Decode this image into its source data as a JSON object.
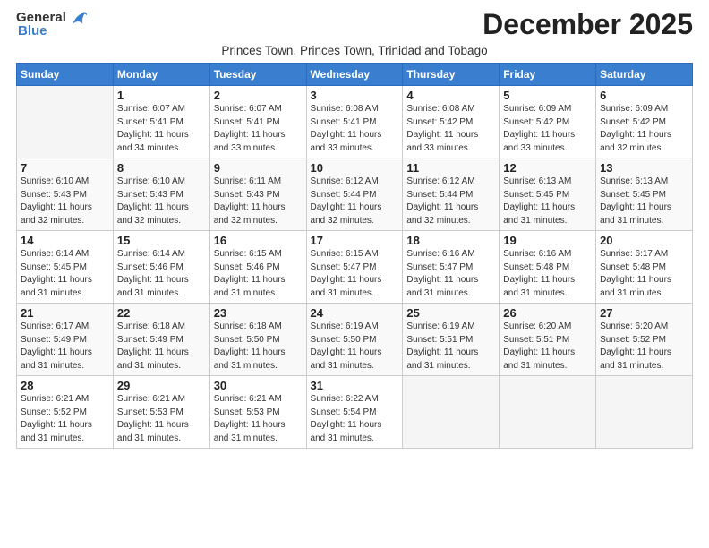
{
  "logo": {
    "general": "General",
    "blue": "Blue"
  },
  "title": "December 2025",
  "subtitle": "Princes Town, Princes Town, Trinidad and Tobago",
  "days_header": [
    "Sunday",
    "Monday",
    "Tuesday",
    "Wednesday",
    "Thursday",
    "Friday",
    "Saturday"
  ],
  "weeks": [
    [
      {
        "num": "",
        "info": ""
      },
      {
        "num": "1",
        "info": "Sunrise: 6:07 AM\nSunset: 5:41 PM\nDaylight: 11 hours\nand 34 minutes."
      },
      {
        "num": "2",
        "info": "Sunrise: 6:07 AM\nSunset: 5:41 PM\nDaylight: 11 hours\nand 33 minutes."
      },
      {
        "num": "3",
        "info": "Sunrise: 6:08 AM\nSunset: 5:41 PM\nDaylight: 11 hours\nand 33 minutes."
      },
      {
        "num": "4",
        "info": "Sunrise: 6:08 AM\nSunset: 5:42 PM\nDaylight: 11 hours\nand 33 minutes."
      },
      {
        "num": "5",
        "info": "Sunrise: 6:09 AM\nSunset: 5:42 PM\nDaylight: 11 hours\nand 33 minutes."
      },
      {
        "num": "6",
        "info": "Sunrise: 6:09 AM\nSunset: 5:42 PM\nDaylight: 11 hours\nand 32 minutes."
      }
    ],
    [
      {
        "num": "7",
        "info": "Sunrise: 6:10 AM\nSunset: 5:43 PM\nDaylight: 11 hours\nand 32 minutes."
      },
      {
        "num": "8",
        "info": "Sunrise: 6:10 AM\nSunset: 5:43 PM\nDaylight: 11 hours\nand 32 minutes."
      },
      {
        "num": "9",
        "info": "Sunrise: 6:11 AM\nSunset: 5:43 PM\nDaylight: 11 hours\nand 32 minutes."
      },
      {
        "num": "10",
        "info": "Sunrise: 6:12 AM\nSunset: 5:44 PM\nDaylight: 11 hours\nand 32 minutes."
      },
      {
        "num": "11",
        "info": "Sunrise: 6:12 AM\nSunset: 5:44 PM\nDaylight: 11 hours\nand 32 minutes."
      },
      {
        "num": "12",
        "info": "Sunrise: 6:13 AM\nSunset: 5:45 PM\nDaylight: 11 hours\nand 31 minutes."
      },
      {
        "num": "13",
        "info": "Sunrise: 6:13 AM\nSunset: 5:45 PM\nDaylight: 11 hours\nand 31 minutes."
      }
    ],
    [
      {
        "num": "14",
        "info": "Sunrise: 6:14 AM\nSunset: 5:45 PM\nDaylight: 11 hours\nand 31 minutes."
      },
      {
        "num": "15",
        "info": "Sunrise: 6:14 AM\nSunset: 5:46 PM\nDaylight: 11 hours\nand 31 minutes."
      },
      {
        "num": "16",
        "info": "Sunrise: 6:15 AM\nSunset: 5:46 PM\nDaylight: 11 hours\nand 31 minutes."
      },
      {
        "num": "17",
        "info": "Sunrise: 6:15 AM\nSunset: 5:47 PM\nDaylight: 11 hours\nand 31 minutes."
      },
      {
        "num": "18",
        "info": "Sunrise: 6:16 AM\nSunset: 5:47 PM\nDaylight: 11 hours\nand 31 minutes."
      },
      {
        "num": "19",
        "info": "Sunrise: 6:16 AM\nSunset: 5:48 PM\nDaylight: 11 hours\nand 31 minutes."
      },
      {
        "num": "20",
        "info": "Sunrise: 6:17 AM\nSunset: 5:48 PM\nDaylight: 11 hours\nand 31 minutes."
      }
    ],
    [
      {
        "num": "21",
        "info": "Sunrise: 6:17 AM\nSunset: 5:49 PM\nDaylight: 11 hours\nand 31 minutes."
      },
      {
        "num": "22",
        "info": "Sunrise: 6:18 AM\nSunset: 5:49 PM\nDaylight: 11 hours\nand 31 minutes."
      },
      {
        "num": "23",
        "info": "Sunrise: 6:18 AM\nSunset: 5:50 PM\nDaylight: 11 hours\nand 31 minutes."
      },
      {
        "num": "24",
        "info": "Sunrise: 6:19 AM\nSunset: 5:50 PM\nDaylight: 11 hours\nand 31 minutes."
      },
      {
        "num": "25",
        "info": "Sunrise: 6:19 AM\nSunset: 5:51 PM\nDaylight: 11 hours\nand 31 minutes."
      },
      {
        "num": "26",
        "info": "Sunrise: 6:20 AM\nSunset: 5:51 PM\nDaylight: 11 hours\nand 31 minutes."
      },
      {
        "num": "27",
        "info": "Sunrise: 6:20 AM\nSunset: 5:52 PM\nDaylight: 11 hours\nand 31 minutes."
      }
    ],
    [
      {
        "num": "28",
        "info": "Sunrise: 6:21 AM\nSunset: 5:52 PM\nDaylight: 11 hours\nand 31 minutes."
      },
      {
        "num": "29",
        "info": "Sunrise: 6:21 AM\nSunset: 5:53 PM\nDaylight: 11 hours\nand 31 minutes."
      },
      {
        "num": "30",
        "info": "Sunrise: 6:21 AM\nSunset: 5:53 PM\nDaylight: 11 hours\nand 31 minutes."
      },
      {
        "num": "31",
        "info": "Sunrise: 6:22 AM\nSunset: 5:54 PM\nDaylight: 11 hours\nand 31 minutes."
      },
      {
        "num": "",
        "info": ""
      },
      {
        "num": "",
        "info": ""
      },
      {
        "num": "",
        "info": ""
      }
    ]
  ]
}
